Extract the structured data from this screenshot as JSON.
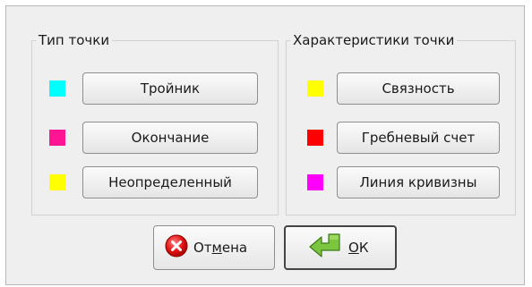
{
  "point_type": {
    "title": "Тип точки",
    "items": [
      {
        "label": "Тройник",
        "color": "#00ffff"
      },
      {
        "label": "Окончание",
        "color": "#ff1493"
      },
      {
        "label": "Неопределенный",
        "color": "#ffff00"
      }
    ]
  },
  "point_props": {
    "title": "Характеристики точки",
    "items": [
      {
        "label": "Связность",
        "color": "#ffff00"
      },
      {
        "label": "Гребневый счет",
        "color": "#ff0000"
      },
      {
        "label": "Линия кривизны",
        "color": "#ff00ff"
      }
    ]
  },
  "footer": {
    "cancel": {
      "pre": "От",
      "mnemonic": "м",
      "post": "ена",
      "icon": "cancel-circle-icon"
    },
    "ok": {
      "pre": "",
      "mnemonic": "О",
      "post": "К",
      "icon": "green-return-arrow-icon"
    }
  }
}
